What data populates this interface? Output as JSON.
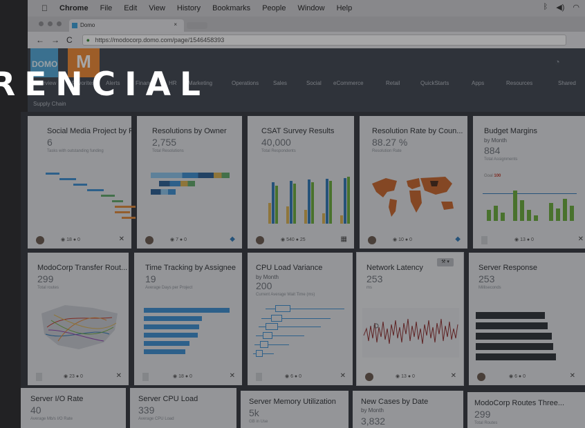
{
  "menubar": {
    "apple": "",
    "app": "Chrome",
    "items": [
      "File",
      "Edit",
      "View",
      "History",
      "Bookmarks",
      "People",
      "Window",
      "Help"
    ],
    "status_icons": [
      "wifi-icon",
      "volume-icon",
      "bluetooth-icon"
    ]
  },
  "browser": {
    "tab_title": "Domo",
    "tab_close": "×",
    "back": "←",
    "forward": "→",
    "reload": "C",
    "url": "https://modocorp.domo.com/page/1546458393"
  },
  "header": {
    "logo_domo": "DOMO",
    "logo_m": "M",
    "nav": [
      "Overview",
      "Favorites",
      "Alerts",
      "Finance",
      "HR",
      "Marketing",
      "Operations",
      "Sales",
      "Social",
      "eCommerce",
      "Retail",
      "QuickStarts",
      "Apps",
      "Resources",
      "Shared"
    ],
    "subnav": "Supply Chain"
  },
  "banner": "RENCIAL",
  "cards": [
    {
      "title": "Social Media Project by F...",
      "value": "6",
      "caption": "Tasks with outstanding funding",
      "views": "18",
      "comments": "0"
    },
    {
      "title": "Resolutions by Owner",
      "value": "2,755",
      "caption": "Total Resolutions",
      "views": "7",
      "comments": "0"
    },
    {
      "title": "CSAT Survey Results",
      "value": "40,000",
      "caption": "Total Respondents",
      "views": "540",
      "comments": "25"
    },
    {
      "title": "Resolution Rate by Coun...",
      "value": "88.27 %",
      "caption": "Resolution Rate",
      "views": "10",
      "comments": "0"
    },
    {
      "title": "Budget Margins",
      "subtitle": "by Month",
      "value": "884",
      "caption": "Total Assignments",
      "goal_label": "Goal",
      "goal_value": "100",
      "views": "13",
      "comments": "0"
    },
    {
      "title": "ModoCorp Transfer Rout...",
      "value": "299",
      "caption": "Total routes",
      "views": "23",
      "comments": "0"
    },
    {
      "title": "Time Tracking by Assignee",
      "value": "19",
      "caption": "Average Days per Project",
      "views": "18",
      "comments": "0"
    },
    {
      "title": "CPU Load Variance",
      "subtitle": "by Month",
      "value": "200",
      "caption": "Current Average Wait Time (ms)",
      "views": "6",
      "comments": "0"
    },
    {
      "title": "Network Latency",
      "value": "253",
      "caption": "ms",
      "views": "13",
      "comments": "0"
    },
    {
      "title": "Server Response",
      "value": "253",
      "caption": "Milliseconds",
      "views": "6",
      "comments": "0"
    },
    {
      "title": "Server I/O Rate",
      "value": "40",
      "caption": "Average Mb/s I/O Rate"
    },
    {
      "title": "Server CPU Load",
      "value": "339",
      "caption": "Average CPU Load"
    },
    {
      "title": "Server Memory Utilization",
      "value": "5k",
      "caption": "GB in Use"
    },
    {
      "title": "New Cases by Date",
      "subtitle": "by Month",
      "value": "3,832",
      "caption": ""
    },
    {
      "title": "ModoCorp Routes Three...",
      "value": "299",
      "caption": "Total Routes"
    }
  ],
  "icons": {
    "eye": "◉",
    "comment": "●",
    "collapse": "✕",
    "table": "▦",
    "chat": "◆",
    "wrench": "🔧"
  },
  "colors": {
    "card_bg": "#e2e4e7",
    "header_bg": "#3f4650",
    "logo_blue": "#52a9d9",
    "logo_orange": "#f08a33",
    "accent_green": "#6aab3a",
    "accent_blue": "#2f78b5"
  }
}
